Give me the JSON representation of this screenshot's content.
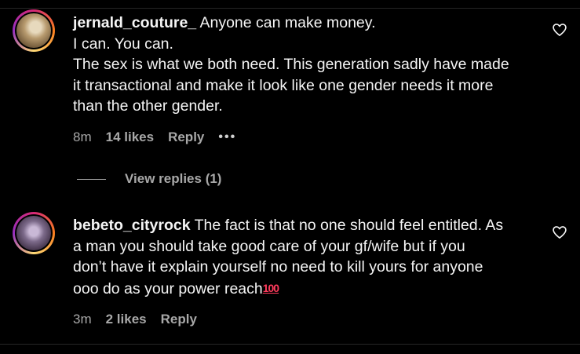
{
  "comments": [
    {
      "username": "jernald_couture_",
      "text_first": "Anyone can make money.",
      "lines": [
        "I can. You can.",
        "The sex is what we both need. This generation sadly have made",
        "it transactional and make it look like one gender needs it more",
        "than the other gender."
      ],
      "time": "8m",
      "likes": "14 likes",
      "reply": "Reply",
      "more": "•••"
    },
    {
      "username": "bebeto_cityrock",
      "text_first": "The fact is that no one should feel entitled. As",
      "lines": [
        "a man you should take good care of your gf/wife but if you",
        "don’t have it explain yourself no need to kill yours for anyone",
        "ooo do as your power reach"
      ],
      "emoji": "100",
      "time": "3m",
      "likes": "2 likes",
      "reply": "Reply"
    }
  ],
  "view_replies": "View replies (1)",
  "icons": {
    "like": "heart-outline-icon",
    "more": "more-options-icon",
    "emoji": "hundred-points-emoji-icon"
  },
  "colors": {
    "background": "#000000",
    "text": "#f5f5f5",
    "muted": "#a8a8a8",
    "emoji": "#ff3b5c"
  }
}
